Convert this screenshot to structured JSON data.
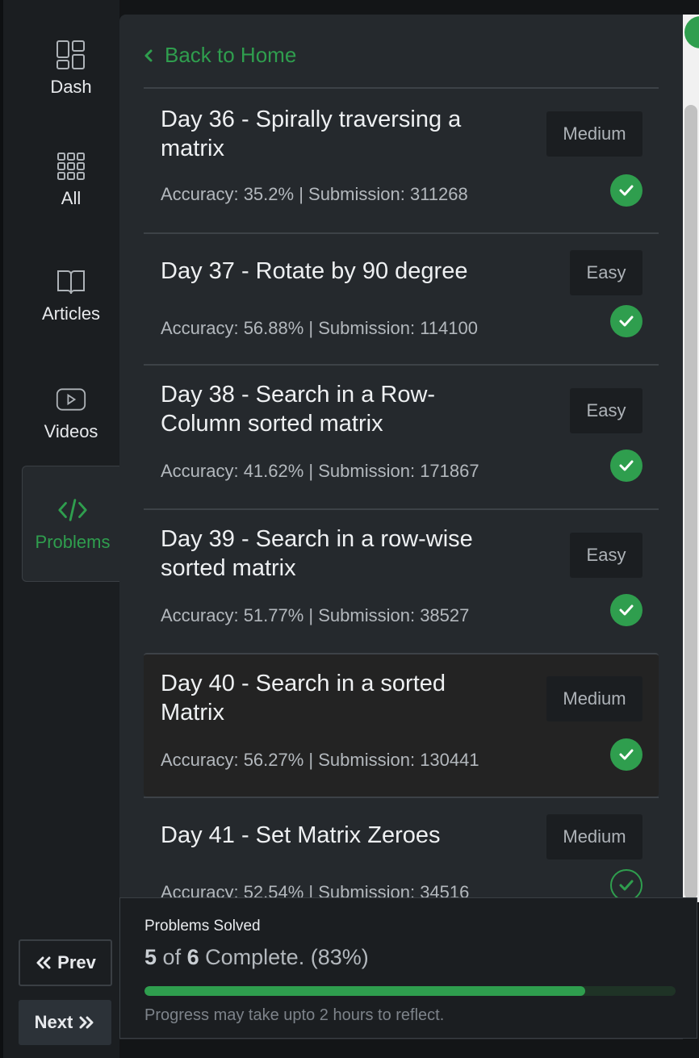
{
  "sidebar": {
    "items": [
      {
        "label": "Dash",
        "icon": "dashboard-icon"
      },
      {
        "label": "All",
        "icon": "grid-icon"
      },
      {
        "label": "Articles",
        "icon": "book-icon"
      },
      {
        "label": "Videos",
        "icon": "play-icon"
      },
      {
        "label": "Problems",
        "icon": "code-icon",
        "active": true
      }
    ],
    "prev_label": "Prev",
    "next_label": "Next"
  },
  "header": {
    "back_label": "Back to Home"
  },
  "problems": [
    {
      "title": "Day 36 - Spirally traversing a matrix",
      "accuracy": "Accuracy: 35.2% | Submission: 311268",
      "difficulty": "Medium",
      "solved": true
    },
    {
      "title": "Day 37 - Rotate by 90 degree",
      "accuracy": "Accuracy: 56.88% | Submission: 114100",
      "difficulty": "Easy",
      "solved": true
    },
    {
      "title": "Day 38 - Search in a Row-Column sorted matrix",
      "accuracy": "Accuracy: 41.62% | Submission: 171867",
      "difficulty": "Easy",
      "solved": true
    },
    {
      "title": "Day 39 - Search in a row-wise sorted matrix",
      "accuracy": "Accuracy: 51.77% | Submission: 38527",
      "difficulty": "Easy",
      "solved": true
    },
    {
      "title": "Day 40 - Search in a sorted Matrix",
      "accuracy": "Accuracy: 56.27% | Submission: 130441",
      "difficulty": "Medium",
      "solved": true
    },
    {
      "title": "Day 41 - Set Matrix Zeroes",
      "accuracy": "Accuracy: 52.54% | Submission: 34516",
      "difficulty": "Medium",
      "solved": false
    }
  ],
  "progress": {
    "title": "Problems Solved",
    "solved": "5",
    "of_text": "of",
    "total": "6",
    "complete_text": "Complete. (83%)",
    "percent": 83,
    "note": "Progress may take upto 2 hours to reflect."
  },
  "colors": {
    "accent": "#2f9e4e",
    "panel": "#25292d",
    "sidebar": "#1b1e21"
  }
}
